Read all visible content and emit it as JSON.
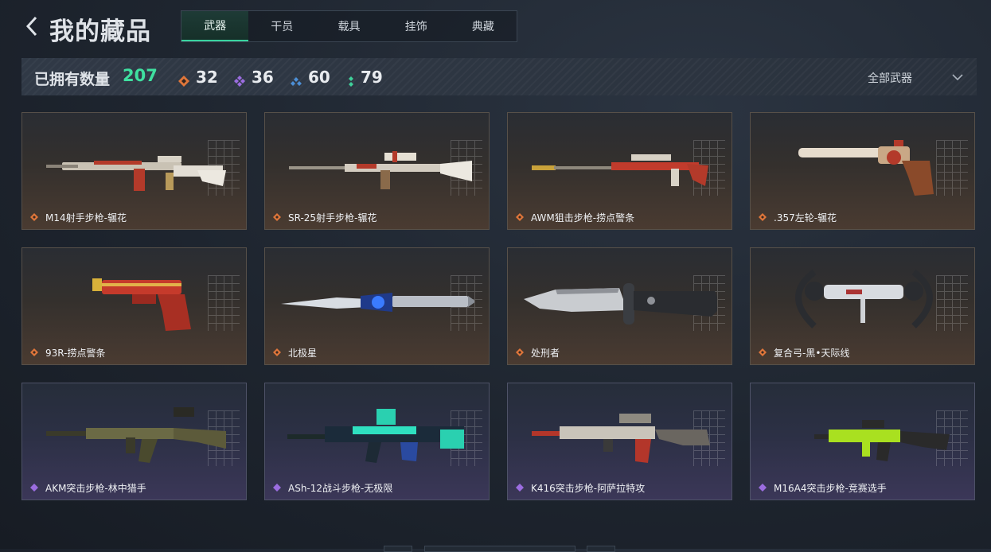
{
  "header": {
    "title": "我的藏品",
    "tabs": [
      {
        "label": "武器",
        "active": true
      },
      {
        "label": "干员",
        "active": false
      },
      {
        "label": "载具",
        "active": false
      },
      {
        "label": "挂饰",
        "active": false
      },
      {
        "label": "典藏",
        "active": false
      }
    ]
  },
  "stats": {
    "owned_label": "已拥有数量",
    "owned_count": "207",
    "rarity_counts": [
      {
        "icon": "orange-diamond-icon",
        "color": "#e0763a",
        "value": "32"
      },
      {
        "icon": "purple-diamond-icon",
        "color": "#9b6de0",
        "value": "36"
      },
      {
        "icon": "blue-diamond-icon",
        "color": "#4c8fd6",
        "value": "60"
      },
      {
        "icon": "green-dots-icon",
        "color": "#3fd09a",
        "value": "79"
      }
    ],
    "filter_label": "全部武器"
  },
  "items": [
    {
      "name": "M14射手步枪-辗花",
      "rarity": "gold"
    },
    {
      "name": "SR-25射手步枪-辗花",
      "rarity": "gold"
    },
    {
      "name": "AWM狙击步枪-捞点警条",
      "rarity": "gold"
    },
    {
      "name": ".357左轮-辗花",
      "rarity": "gold"
    },
    {
      "name": "93R-捞点警条",
      "rarity": "gold"
    },
    {
      "name": "北极星",
      "rarity": "gold"
    },
    {
      "name": "处刑者",
      "rarity": "gold"
    },
    {
      "name": "复合弓-黑•天际线",
      "rarity": "gold"
    },
    {
      "name": "AKM突击步枪-林中猎手",
      "rarity": "purple"
    },
    {
      "name": "ASh-12战斗步枪-无极限",
      "rarity": "purple"
    },
    {
      "name": "K416突击步枪-阿萨拉特攻",
      "rarity": "purple"
    },
    {
      "name": "M16A4突击步枪-竞赛选手",
      "rarity": "purple"
    }
  ],
  "colors": {
    "accent": "#3fe0a0",
    "gold_rarity": "#e0763a",
    "purple_rarity": "#9b6de0"
  }
}
